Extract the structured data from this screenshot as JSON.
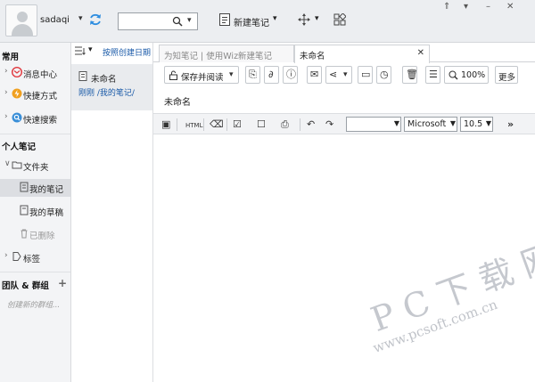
{
  "user": {
    "name": "sadaqi"
  },
  "search": {
    "value": "",
    "placeholder": ""
  },
  "actions": {
    "new_note_label": "新建笔记"
  },
  "window": {
    "controls": [
      "⇑",
      "▾",
      "–",
      "✕"
    ]
  },
  "sidebar": {
    "sections": {
      "common": "常用",
      "personal": "个人笔记",
      "team": "团队 & 群组"
    },
    "common_items": [
      {
        "label": "消息中心",
        "icon": "message-center-icon"
      },
      {
        "label": "快捷方式",
        "icon": "shortcut-icon"
      },
      {
        "label": "快速搜索",
        "icon": "quick-search-icon"
      }
    ],
    "personal_items": [
      {
        "label": "文件夹",
        "icon": "folder-icon"
      },
      {
        "label": "我的笔记",
        "icon": "my-notes-icon"
      },
      {
        "label": "我的草稿",
        "icon": "drafts-icon"
      },
      {
        "label": "已删除",
        "icon": "trash-icon"
      },
      {
        "label": "标签",
        "icon": "tag-icon"
      }
    ],
    "team_action": "创建新的群组..."
  },
  "notelist": {
    "sort_label": "按照创建日期",
    "notes": [
      {
        "title": "未命名",
        "meta": "刚刚  /我的笔记/"
      }
    ]
  },
  "editor": {
    "tabs": [
      {
        "label": "为知笔记 | 使用Wiz新建笔记"
      },
      {
        "label": "未命名"
      }
    ],
    "save_read_label": "保存并阅读",
    "zoom_label": "100%",
    "more_label": "更多",
    "note_title": "未命名",
    "html_label": "HTML",
    "font_family": "Microsoft",
    "font_size": "10.5"
  },
  "watermark": {
    "logo": "PC下载网",
    "url": "www.pcsoft.com.cn"
  },
  "colors": {
    "accent": "#1a5aa8",
    "sidebar_bg": "#f3f4f6",
    "topbar_bg": "#eceef1",
    "message_red": "#e0383e",
    "shortcut_orange": "#f0a020"
  }
}
